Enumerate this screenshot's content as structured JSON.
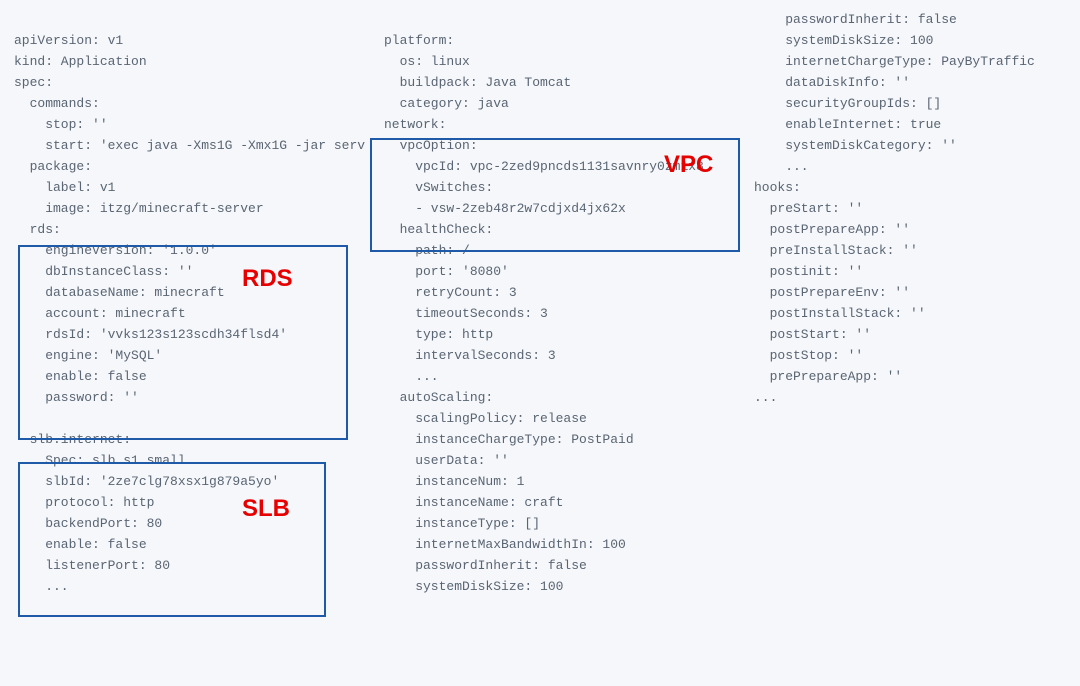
{
  "labels": {
    "rds": "RDS",
    "slb": "SLB",
    "vpc": "VPC"
  },
  "col1": {
    "l0": "",
    "l1": "apiVersion: v1",
    "l2": "kind: Application",
    "l3": "spec:",
    "l4": "  commands:",
    "l5": "    stop: ''",
    "l6": "    start: 'exec java -Xms1G -Xmx1G -jar serv",
    "l7": "  package:",
    "l8": "    label: v1",
    "l9": "    image: itzg/minecraft-server",
    "l10": "  rds:",
    "l11": "    engineVersion: '1.0.0'",
    "l12": "    dbInstanceClass: ''",
    "l13": "    databaseName: minecraft",
    "l14": "    account: minecraft",
    "l15": "    rdsId: 'vvks123s123scdh34flsd4'",
    "l16": "    engine: 'MySQL'",
    "l17": "    enable: false",
    "l18": "    password: ''",
    "l19": "",
    "l20": "  slb.internet:",
    "l21": "    Spec: slb.s1.small",
    "l22": "    slbId: '2ze7clg78xsx1g879a5yo'",
    "l23": "    protocol: http",
    "l24": "    backendPort: 80",
    "l25": "    enable: false",
    "l26": "    listenerPort: 80",
    "l27": "    ..."
  },
  "col2": {
    "l0": "",
    "l1": "platform:",
    "l2": "  os: linux",
    "l3": "  buildpack: Java Tomcat",
    "l4": "  category: java",
    "l5": "network:",
    "l6": "  vpcOption:",
    "l7": "    vpcId: vpc-2zed9pncds1131savnry0zm1x8",
    "l8": "    vSwitches:",
    "l9": "    - vsw-2zeb48r2w7cdjxd4jx62x",
    "l10": "  healthCheck:",
    "l11": "    path: /",
    "l12": "    port: '8080'",
    "l13": "    retryCount: 3",
    "l14": "    timeoutSeconds: 3",
    "l15": "    type: http",
    "l16": "    intervalSeconds: 3",
    "l17": "    ...",
    "l18": "  autoScaling:",
    "l19": "    scalingPolicy: release",
    "l20": "    instanceChargeType: PostPaid",
    "l21": "    userData: ''",
    "l22": "    instanceNum: 1",
    "l23": "    instanceName: craft",
    "l24": "    instanceType: []",
    "l25": "    internetMaxBandwidthIn: 100",
    "l26": "    passwordInherit: false",
    "l27": "    systemDiskSize: 100"
  },
  "col3": {
    "l0": "    passwordInherit: false",
    "l1": "    systemDiskSize: 100",
    "l2": "    internetChargeType: PayByTraffic",
    "l3": "    dataDiskInfo: ''",
    "l4": "    securityGroupIds: []",
    "l5": "    enableInternet: true",
    "l6": "    systemDiskCategory: ''",
    "l7": "    ...",
    "l8": "hooks:",
    "l9": "  preStart: ''",
    "l10": "  postPrepareApp: ''",
    "l11": "  preInstallStack: ''",
    "l12": "  postinit: ''",
    "l13": "  postPrepareEnv: ''",
    "l14": "  postInstallStack: ''",
    "l15": "  postStart: ''",
    "l16": "  postStop: ''",
    "l17": "  prePrepareApp: ''",
    "l18": "..."
  }
}
